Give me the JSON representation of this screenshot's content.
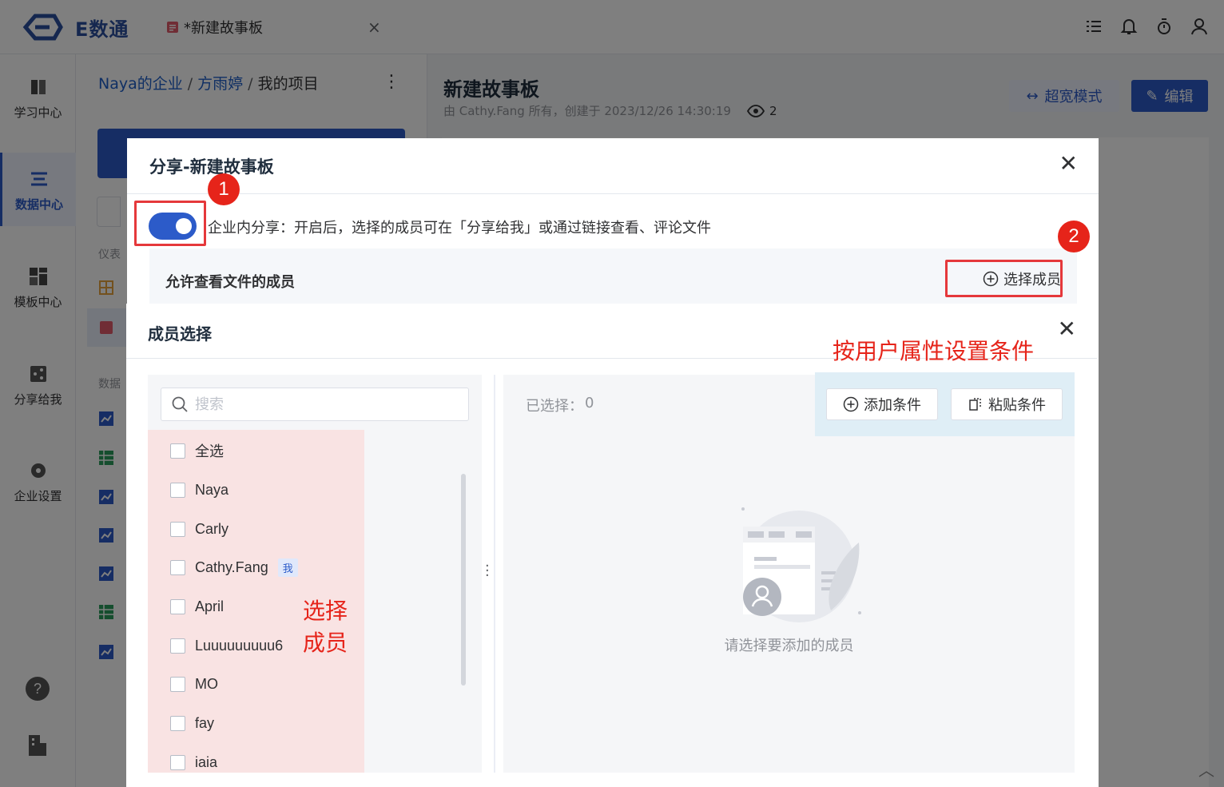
{
  "app": {
    "logo_text": "E数通",
    "doc_tab_label": "*新建故事板",
    "doc_tab_close": "×"
  },
  "top_icons": [
    "task-list-icon",
    "bell-icon",
    "timer-icon",
    "user-icon"
  ],
  "nav": {
    "items": [
      {
        "label": "学习中心",
        "icon": "learning-icon"
      },
      {
        "label": "数据中心",
        "icon": "data-list-icon",
        "active": true
      },
      {
        "label": "模板中心",
        "icon": "template-icon"
      },
      {
        "label": "分享给我",
        "icon": "share-icon"
      },
      {
        "label": "企业设置",
        "icon": "settings-gear-icon"
      }
    ],
    "bottom_icons": [
      "help-icon",
      "building-icon"
    ]
  },
  "breadcrumb": {
    "org": "Naya的企业",
    "user": "方雨婷",
    "current": "我的项目",
    "separator": "/"
  },
  "col2": {
    "more": "⋮",
    "section_1_partial": "仪表",
    "section_2_partial": "数据"
  },
  "main": {
    "title": "新建故事板",
    "meta": "由 Cathy.Fang 所有，创建于 2023/12/26 14:30:19",
    "views": "2",
    "wide_mode_label": "超宽模式",
    "edit_label": "编辑"
  },
  "share_dialog": {
    "title": "分享-新建故事板",
    "close": "✕",
    "enabled": true,
    "description": "企业内分享：开启后，选择的成员可在「分享给我」或通过链接查看、评论文件",
    "permission_label": "允许查看文件的成员",
    "select_members_label": "选择成员"
  },
  "markers": {
    "one": "1",
    "two": "2"
  },
  "member_dialog": {
    "title": "成员选择",
    "close": "✕",
    "search_placeholder": "搜索",
    "select_all": "全选",
    "members": [
      {
        "name": "Naya"
      },
      {
        "name": "Carly"
      },
      {
        "name": "Cathy.Fang",
        "tag": "我"
      },
      {
        "name": "April"
      },
      {
        "name": "Luuuuuuuuu6"
      },
      {
        "name": "MO"
      },
      {
        "name": "fay"
      },
      {
        "name": "iaia"
      }
    ],
    "selected_label": "已选择：",
    "selected_count": "0",
    "add_condition_label": "添加条件",
    "paste_condition_label": "粘贴条件",
    "empty_text": "请选择要添加的成员"
  },
  "annotations": {
    "select_members": "选择成员",
    "conditions": "按用户属性设置条件"
  },
  "colors": {
    "primary": "#2c5bc9",
    "annotation_red": "#e6241a",
    "pink_highlight": "#f9e3e3",
    "blue_highlight": "#dfeef6"
  }
}
